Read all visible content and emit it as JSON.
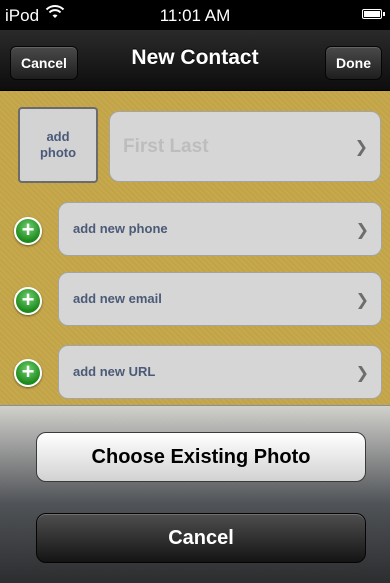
{
  "status_bar": {
    "carrier": "iPod",
    "wifi_icon": "wifi-icon",
    "time": "11:01 AM",
    "battery_icon": "battery-icon"
  },
  "nav": {
    "cancel_label": "Cancel",
    "title": "New Contact",
    "done_label": "Done"
  },
  "form": {
    "add_photo_label": "add photo",
    "name_placeholder": "First Last",
    "fields": [
      {
        "label": "add new phone"
      },
      {
        "label": "add new email"
      },
      {
        "label": "add new URL"
      }
    ]
  },
  "action_sheet": {
    "choose_photo_label": "Choose Existing Photo",
    "cancel_label": "Cancel"
  },
  "colors": {
    "background": "#c7a94c",
    "add_icon": "#2a9a2a",
    "label_text": "#4b5a76"
  },
  "icons": {
    "chevron": "chevron-right-icon",
    "add": "plus-circle-icon"
  }
}
